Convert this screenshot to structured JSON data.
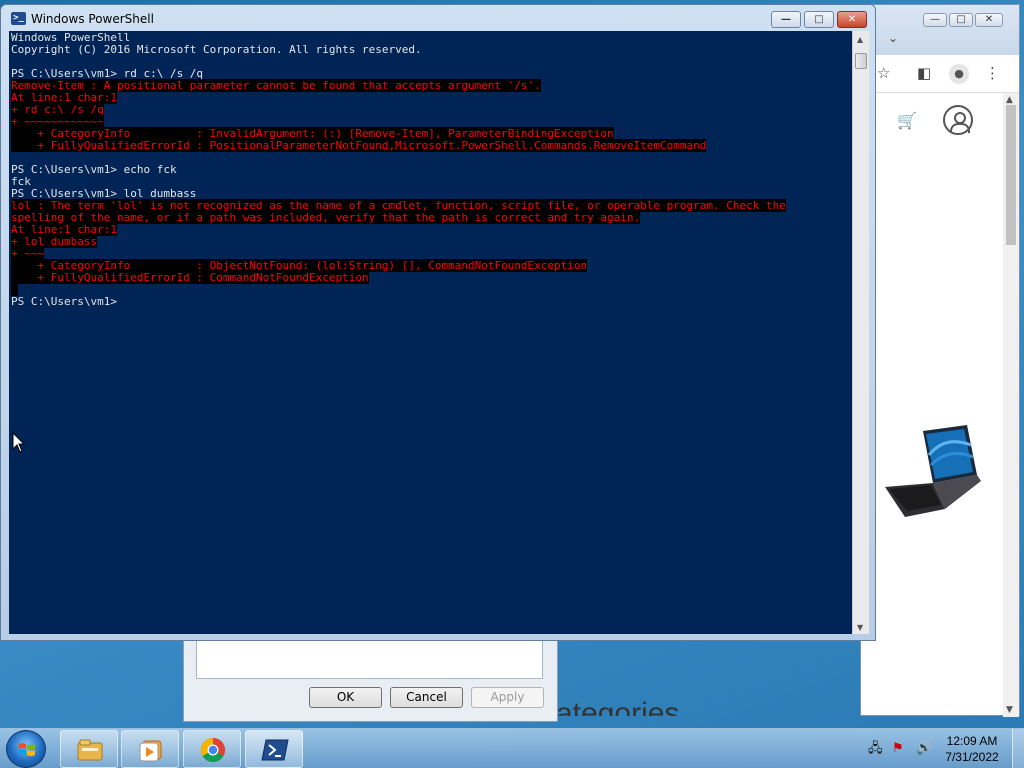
{
  "powershell": {
    "title": "Windows PowerShell",
    "logo_glyph": ">_",
    "lines": [
      {
        "text": "Windows PowerShell",
        "error": false
      },
      {
        "text": "Copyright (C) 2016 Microsoft Corporation. All rights reserved.",
        "error": false
      },
      {
        "text": "",
        "error": false
      },
      {
        "text": "PS C:\\Users\\vm1> rd c:\\ /s /q",
        "error": false
      },
      {
        "text": "Remove-Item : A positional parameter cannot be found that accepts argument '/s'.",
        "error": true
      },
      {
        "text": "At line:1 char:1",
        "error": true
      },
      {
        "text": "+ rd c:\\ /s /q",
        "error": true
      },
      {
        "text": "+ ~~~~~~~~~~~~",
        "error": true
      },
      {
        "text": "    + CategoryInfo          : InvalidArgument: (:) [Remove-Item], ParameterBindingException",
        "error": true
      },
      {
        "text": "    + FullyQualifiedErrorId : PositionalParameterNotFound,Microsoft.PowerShell.Commands.RemoveItemCommand",
        "error": true
      },
      {
        "text": "",
        "error": false
      },
      {
        "text": "PS C:\\Users\\vm1> echo fck",
        "error": false
      },
      {
        "text": "fck",
        "error": false
      },
      {
        "text": "PS C:\\Users\\vm1> lol dumbass",
        "error": false
      },
      {
        "text": "lol : The term 'lol' is not recognized as the name of a cmdlet, function, script file, or operable program. Check the",
        "error": true
      },
      {
        "text": "spelling of the name, or if a path was included, verify that the path is correct and try again.",
        "error": true
      },
      {
        "text": "At line:1 char:1",
        "error": true
      },
      {
        "text": "+ lol dumbass",
        "error": true
      },
      {
        "text": "+ ~~~",
        "error": true
      },
      {
        "text": "    + CategoryInfo          : ObjectNotFound: (lol:String) [], CommandNotFoundException",
        "error": true
      },
      {
        "text": "    + FullyQualifiedErrorId : CommandNotFoundException",
        "error": true
      },
      {
        "text": " ",
        "error": true
      },
      {
        "text": "PS C:\\Users\\vm1>",
        "error": false
      }
    ],
    "controls": {
      "minimize": "—",
      "maximize": "□",
      "close": "✕"
    }
  },
  "browser": {
    "controls": {
      "minimize": "—",
      "maximize": "□",
      "close": "✕"
    },
    "tab_chevron": "⌄",
    "toolbar_icons": [
      "star-icon",
      "sidebar-icon",
      "profile-icon",
      "menu-icon"
    ],
    "star_glyph": "☆",
    "sidebar_glyph": "◧",
    "profile_glyph": "●",
    "menu_glyph": "⋮",
    "cart_glyph": "🛒"
  },
  "dialog": {
    "ok_label": "OK",
    "cancel_label": "Cancel",
    "apply_label": "Apply"
  },
  "page_partial_text": "ategories",
  "taskbar": {
    "apps": [
      "file-explorer",
      "media-player",
      "chrome",
      "powershell"
    ],
    "clock_time": "12:09 AM",
    "clock_date": "7/31/2022"
  },
  "colors": {
    "console_bg": "#012456",
    "console_fg": "#e6e6e6",
    "error_fg": "#ff0000",
    "error_bg": "#000000"
  }
}
